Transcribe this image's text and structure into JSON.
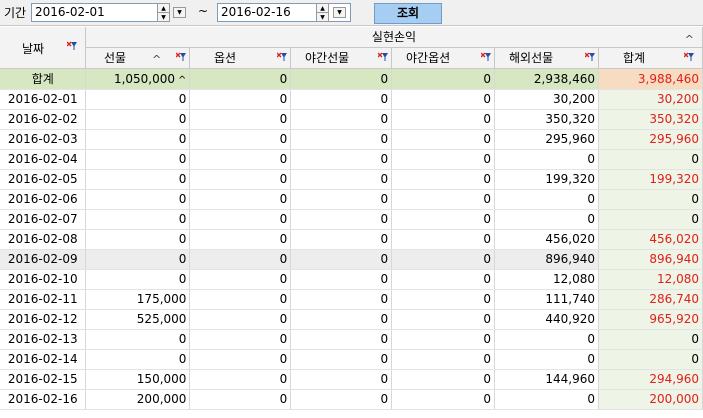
{
  "filter": {
    "period_label": "기간",
    "start_date": "2016-02-01",
    "end_date": "2016-02-16",
    "tilde": "~",
    "query_label": "조회"
  },
  "grid": {
    "group_header": "실현손익",
    "date_header": "날짜",
    "columns": [
      "선물",
      "옵션",
      "야간선물",
      "야간옵션",
      "해외선물",
      "합계"
    ],
    "sum_row": {
      "label": "합계",
      "values": [
        "1,050,000",
        "0",
        "0",
        "0",
        "2,938,460",
        "3,988,460"
      ]
    },
    "rows": [
      {
        "date": "2016-02-01",
        "values": [
          "0",
          "0",
          "0",
          "0",
          "30,200",
          "30,200"
        ]
      },
      {
        "date": "2016-02-02",
        "values": [
          "0",
          "0",
          "0",
          "0",
          "350,320",
          "350,320"
        ]
      },
      {
        "date": "2016-02-03",
        "values": [
          "0",
          "0",
          "0",
          "0",
          "295,960",
          "295,960"
        ]
      },
      {
        "date": "2016-02-04",
        "values": [
          "0",
          "0",
          "0",
          "0",
          "0",
          "0"
        ]
      },
      {
        "date": "2016-02-05",
        "values": [
          "0",
          "0",
          "0",
          "0",
          "199,320",
          "199,320"
        ]
      },
      {
        "date": "2016-02-06",
        "values": [
          "0",
          "0",
          "0",
          "0",
          "0",
          "0"
        ]
      },
      {
        "date": "2016-02-07",
        "values": [
          "0",
          "0",
          "0",
          "0",
          "0",
          "0"
        ]
      },
      {
        "date": "2016-02-08",
        "values": [
          "0",
          "0",
          "0",
          "0",
          "456,020",
          "456,020"
        ]
      },
      {
        "date": "2016-02-09",
        "values": [
          "0",
          "0",
          "0",
          "0",
          "896,940",
          "896,940"
        ]
      },
      {
        "date": "2016-02-10",
        "values": [
          "0",
          "0",
          "0",
          "0",
          "12,080",
          "12,080"
        ]
      },
      {
        "date": "2016-02-11",
        "values": [
          "175,000",
          "0",
          "0",
          "0",
          "111,740",
          "286,740"
        ]
      },
      {
        "date": "2016-02-12",
        "values": [
          "525,000",
          "0",
          "0",
          "0",
          "440,920",
          "965,920"
        ]
      },
      {
        "date": "2016-02-13",
        "values": [
          "0",
          "0",
          "0",
          "0",
          "0",
          "0"
        ]
      },
      {
        "date": "2016-02-14",
        "values": [
          "0",
          "0",
          "0",
          "0",
          "0",
          "0"
        ]
      },
      {
        "date": "2016-02-15",
        "values": [
          "150,000",
          "0",
          "0",
          "0",
          "144,960",
          "294,960"
        ]
      },
      {
        "date": "2016-02-16",
        "values": [
          "200,000",
          "0",
          "0",
          "0",
          "0",
          "200,000"
        ]
      }
    ]
  },
  "colors": {
    "sum_row_bg": "#d6e7c1",
    "sum_total_bg": "#f8dcc2",
    "total_text": "#e0201b",
    "query_button_bg": "#a6cdf2"
  }
}
